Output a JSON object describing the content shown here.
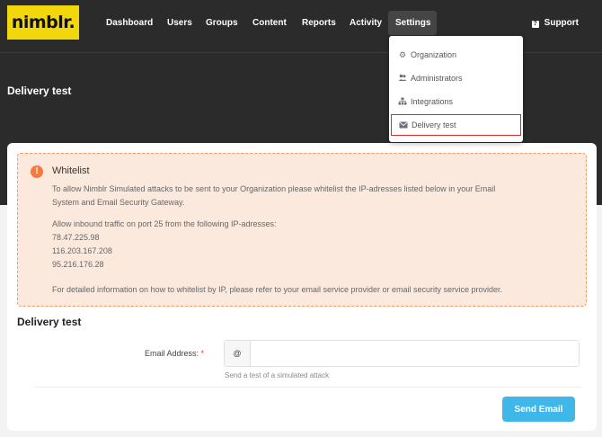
{
  "brand": {
    "logo_text": "nimblr."
  },
  "nav": {
    "items": [
      {
        "label": "Dashboard"
      },
      {
        "label": "Users"
      },
      {
        "label": "Groups"
      },
      {
        "label": "Content"
      },
      {
        "label": "Reports"
      },
      {
        "label": "Activity"
      },
      {
        "label": "Settings",
        "active": true
      }
    ],
    "support_icon": "help-square-icon",
    "support_label": "Support"
  },
  "settings_menu": {
    "items": [
      {
        "label": "Organization",
        "icon": "gear-icon"
      },
      {
        "label": "Administrators",
        "icon": "users-icon"
      },
      {
        "label": "Integrations",
        "icon": "sitemap-icon"
      },
      {
        "label": "Delivery test",
        "icon": "envelope-icon",
        "selected": true
      }
    ]
  },
  "page": {
    "title": "Delivery test"
  },
  "alert": {
    "icon": "exclamation-icon",
    "title": "Whitelist",
    "line1": "To allow Nimblr Simulated attacks to be sent to your Organization please whitelist the IP-adresses listed below in your Email",
    "line2": "System and Email Security Gateway.",
    "line3": "Allow inbound traffic on port 25 from the following IP-adresses:",
    "ips": [
      "78.47.225.98",
      "116.203.167.208",
      "95.216.176.28"
    ],
    "line4": "For detailed information on how to whitelist by IP, please refer to your email service provider or email security service provider."
  },
  "form": {
    "section_title": "Delivery test",
    "email_label": "Email Address:",
    "required_mark": "*",
    "addon": "@",
    "email_value": "",
    "email_placeholder": "",
    "help_text": "Send a test of a simulated attack",
    "submit_label": "Send Email"
  },
  "colors": {
    "topbar": "#2b2b2b",
    "logo_bg": "#f2d70a",
    "alert_bg": "#fce9de",
    "alert_border": "#f09a6c",
    "alert_icon": "#f47b3c",
    "primary_button": "#3fb7e8",
    "selected_outline": "#d32f2f"
  }
}
